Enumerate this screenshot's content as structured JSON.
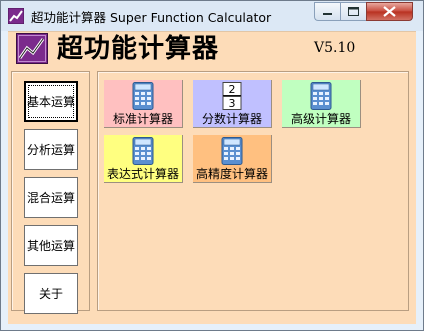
{
  "window": {
    "title": "超功能计算器 Super Function Calculator",
    "minimize_icon": "minimize-icon",
    "maximize_icon": "maximize-icon",
    "close_icon": "close-icon"
  },
  "header": {
    "title": "超功能计算器",
    "version": "V5.10"
  },
  "sidebar": {
    "items": [
      {
        "label": "基本运算",
        "active": true
      },
      {
        "label": "分析运算",
        "active": false
      },
      {
        "label": "混合运算",
        "active": false
      },
      {
        "label": "其他运算",
        "active": false
      },
      {
        "label": "关于",
        "active": false
      }
    ]
  },
  "panel": {
    "calculators": [
      {
        "label": "标准计算器",
        "color": "#ffc0c0",
        "icon": "calculator-icon"
      },
      {
        "label": "分数计算器",
        "color": "#c0c0ff",
        "icon": "fraction-icon"
      },
      {
        "label": "高级计算器",
        "color": "#c0ffc0",
        "icon": "calculator-icon"
      },
      {
        "label": "表达式计算器",
        "color": "#ffff80",
        "icon": "calculator-icon"
      },
      {
        "label": "高精度计算器",
        "color": "#ffc080",
        "icon": "calculator-icon"
      }
    ]
  },
  "colors": {
    "client_background": "#fddcb8",
    "titlebar": "#dce8f5",
    "logo_background": "#7b2a8c"
  }
}
